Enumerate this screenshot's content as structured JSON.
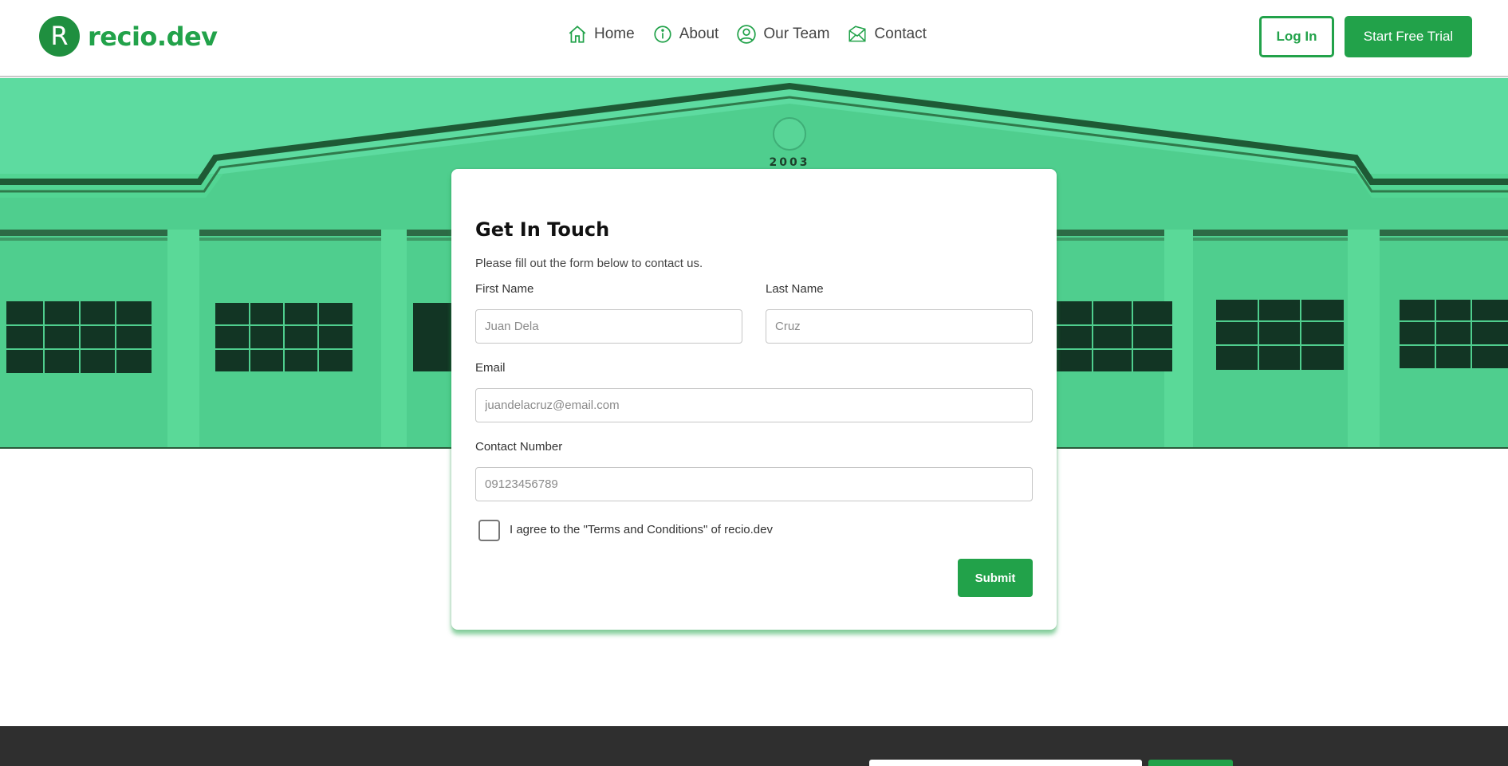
{
  "brand": {
    "mark": "R",
    "name": "recio.dev",
    "accent": "#22a24a"
  },
  "nav": {
    "items": [
      {
        "label": "Home",
        "icon": "home-icon"
      },
      {
        "label": "About",
        "icon": "info-icon"
      },
      {
        "label": "Our Team",
        "icon": "user-circle-icon"
      },
      {
        "label": "Contact",
        "icon": "mail-icon"
      }
    ]
  },
  "header_actions": {
    "login": "Log In",
    "trial": "Start Free Trial"
  },
  "hero": {
    "year_mark": "2003"
  },
  "form": {
    "title": "Get In Touch",
    "subtitle": "Please fill out the form below to contact us.",
    "first_name": {
      "label": "First Name",
      "placeholder": "Juan Dela"
    },
    "last_name": {
      "label": "Last Name",
      "placeholder": "Cruz"
    },
    "email": {
      "label": "Email",
      "placeholder": "juandelacruz@email.com"
    },
    "contact": {
      "label": "Contact Number",
      "placeholder": "09123456789"
    },
    "agree_label": "I agree to the \"Terms and Conditions\" of recio.dev",
    "submit": "Submit"
  }
}
